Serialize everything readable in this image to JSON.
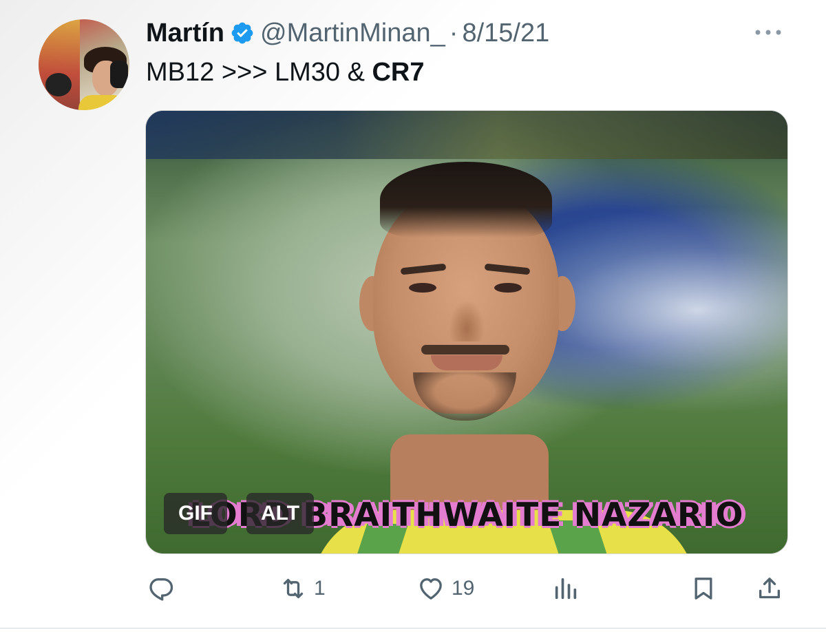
{
  "tweet": {
    "author_name": "Martín",
    "handle": "@MartinMinan_",
    "separator": "·",
    "date": "8/15/21",
    "text_prefix": "MB12 >>> LM30 & ",
    "text_bold": "CR7"
  },
  "media": {
    "caption": "LORD BRAITHWAITE NAZARIO",
    "gif_badge": "GIF",
    "alt_badge": "ALT"
  },
  "actions": {
    "reply_count": "",
    "retweet_count": "1",
    "like_count": "19",
    "views_count": ""
  },
  "icons": {
    "verified": "verified-badge-icon",
    "more": "more-icon",
    "reply": "reply-icon",
    "retweet": "retweet-icon",
    "like": "heart-icon",
    "views": "views-icon",
    "bookmark": "bookmark-icon",
    "share": "share-icon"
  },
  "colors": {
    "verified": "#1d9bf0",
    "secondary_text": "#536471",
    "caption_outline": "#e47cd0"
  }
}
